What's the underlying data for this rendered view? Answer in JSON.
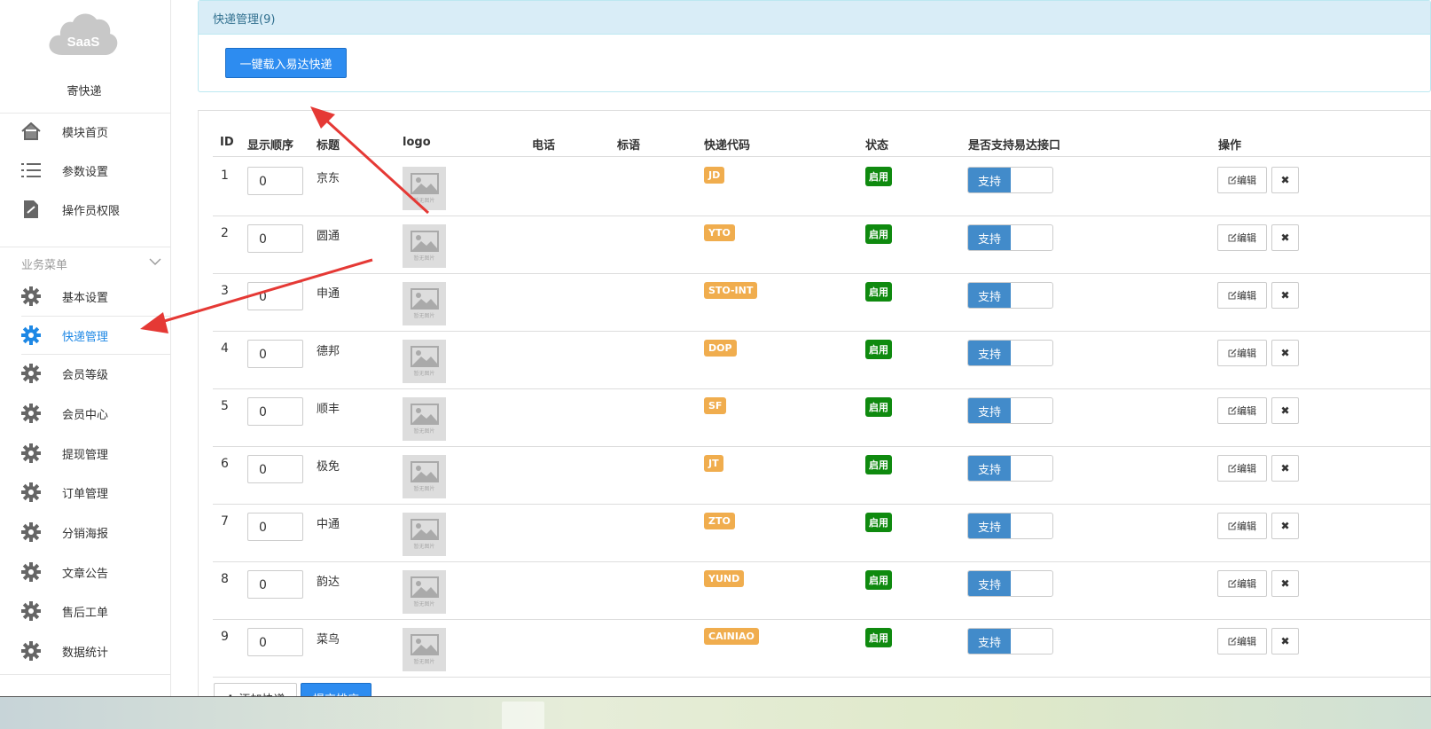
{
  "sidebar": {
    "site_name": "寄快递",
    "logo_text": "SaaS",
    "top_items": [
      {
        "label": "模块首页",
        "icon": "home-icon"
      },
      {
        "label": "参数设置",
        "icon": "list-icon"
      },
      {
        "label": "操作员权限",
        "icon": "edit-doc-icon"
      }
    ],
    "section_label": "业务菜单",
    "items": [
      {
        "label": "基本设置",
        "icon": "gear-icon"
      },
      {
        "label": "快递管理",
        "icon": "gear-icon",
        "active": true
      },
      {
        "label": "会员等级",
        "icon": "gear-icon"
      },
      {
        "label": "会员中心",
        "icon": "gear-icon"
      },
      {
        "label": "提现管理",
        "icon": "gear-icon"
      },
      {
        "label": "订单管理",
        "icon": "gear-icon"
      },
      {
        "label": "分销海报",
        "icon": "gear-icon"
      },
      {
        "label": "文章公告",
        "icon": "gear-icon"
      },
      {
        "label": "售后工单",
        "icon": "gear-icon"
      },
      {
        "label": "数据统计",
        "icon": "gear-icon"
      }
    ]
  },
  "panel": {
    "title": "快递管理(9)",
    "load_button": "一键载入易达快递"
  },
  "table": {
    "headers": {
      "id": "ID",
      "sort": "显示顺序",
      "title": "标题",
      "logo": "logo",
      "phone": "电话",
      "slogan": "标语",
      "code": "快递代码",
      "status": "状态",
      "yida": "是否支持易达接口",
      "ops": "操作"
    },
    "logo_placeholder": "暂无图片",
    "toggle_on_label": "支持",
    "edit_label": "编辑",
    "delete_label": "✖",
    "rows": [
      {
        "id": "1",
        "sort": "0",
        "title": "京东",
        "code": "JD",
        "status": "启用"
      },
      {
        "id": "2",
        "sort": "0",
        "title": "圆通",
        "code": "YTO",
        "status": "启用"
      },
      {
        "id": "3",
        "sort": "0",
        "title": "申通",
        "code": "STO-INT",
        "status": "启用"
      },
      {
        "id": "4",
        "sort": "0",
        "title": "德邦",
        "code": "DOP",
        "status": "启用"
      },
      {
        "id": "5",
        "sort": "0",
        "title": "顺丰",
        "code": "SF",
        "status": "启用"
      },
      {
        "id": "6",
        "sort": "0",
        "title": "极免",
        "code": "JT",
        "status": "启用"
      },
      {
        "id": "7",
        "sort": "0",
        "title": "中通",
        "code": "ZTO",
        "status": "启用"
      },
      {
        "id": "8",
        "sort": "0",
        "title": "韵达",
        "code": "YUND",
        "status": "启用"
      },
      {
        "id": "9",
        "sort": "0",
        "title": "菜鸟",
        "code": "CAINIAO",
        "status": "启用"
      }
    ]
  },
  "bottom": {
    "add_button": "✚ 添加快递",
    "submit_button": "提交排序"
  },
  "colors": {
    "primary": "#2d8cf0",
    "code_badge": "#f0ad4e",
    "status_badge": "#0f8a0f",
    "toggle_on": "#428bca",
    "annotation_arrow": "#e53935"
  }
}
